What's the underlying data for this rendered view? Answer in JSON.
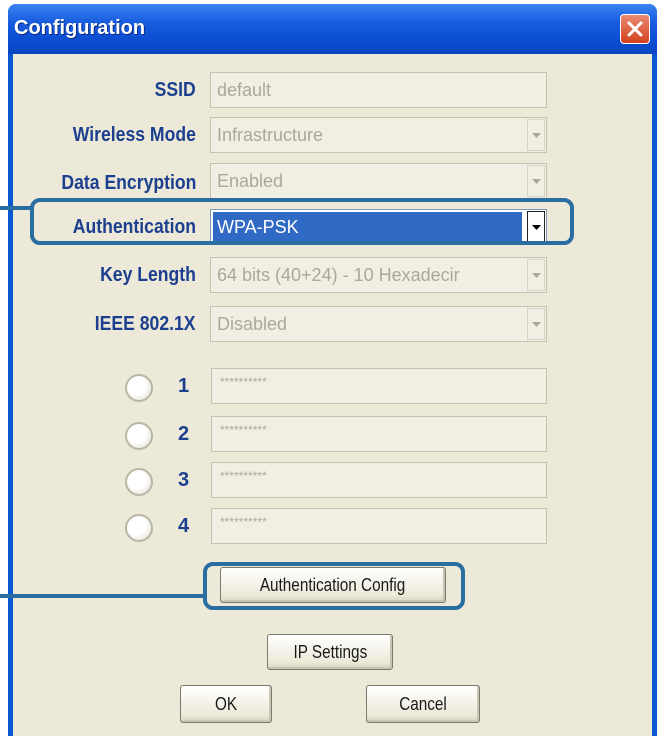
{
  "window": {
    "title": "Configuration",
    "close_icon": "close-icon"
  },
  "form": {
    "ssid": {
      "label": "SSID",
      "value": "default"
    },
    "wireless_mode": {
      "label": "Wireless Mode",
      "value": "Infrastructure"
    },
    "data_encryption": {
      "label": "Data Encryption",
      "value": "Enabled"
    },
    "authentication": {
      "label": "Authentication",
      "value": "WPA-PSK"
    },
    "key_length": {
      "label": "Key Length",
      "value": "64 bits (40+24) - 10 Hexadecir"
    },
    "ieee_8021x": {
      "label": "IEEE 802.1X",
      "value": "Disabled"
    }
  },
  "keys": [
    {
      "number": "1",
      "value": "**********"
    },
    {
      "number": "2",
      "value": "**********"
    },
    {
      "number": "3",
      "value": "**********"
    },
    {
      "number": "4",
      "value": "**********"
    }
  ],
  "buttons": {
    "auth_config": "Authentication Config",
    "ip_settings": "IP Settings",
    "ok": "OK",
    "cancel": "Cancel"
  },
  "colors": {
    "titlebar": "#0a4cd0",
    "label": "#1c3f8f",
    "selection": "#316ac5",
    "highlight_outline": "#2a6da0",
    "close_button": "#d4411d"
  }
}
